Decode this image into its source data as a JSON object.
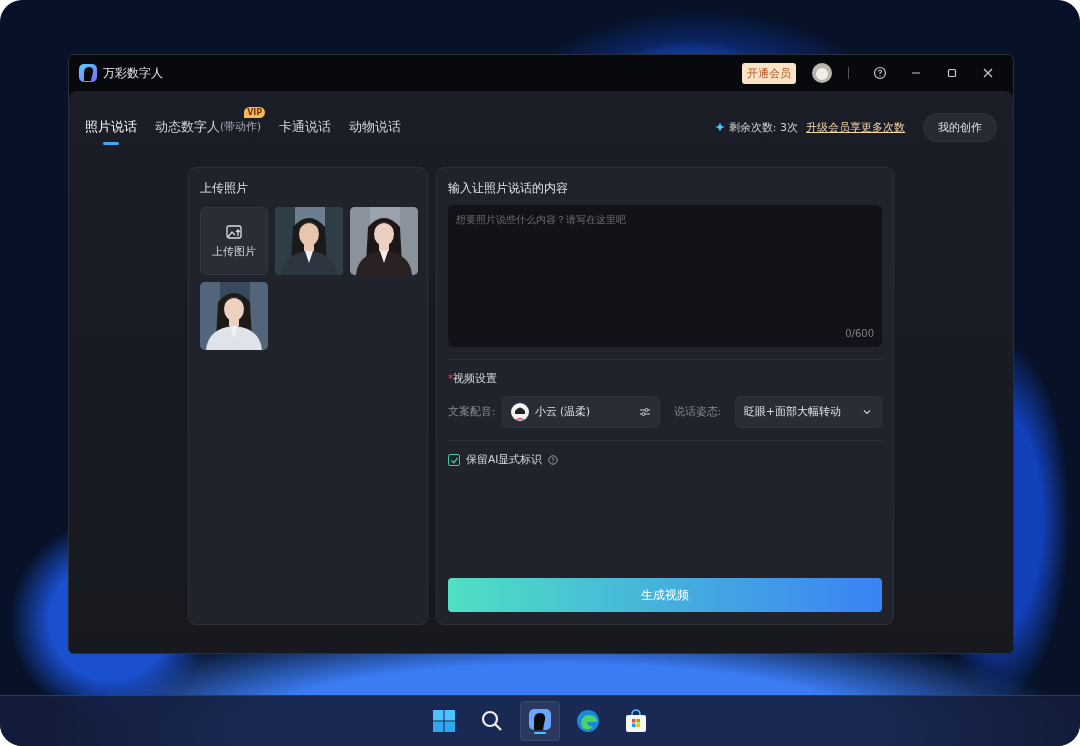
{
  "window": {
    "app_name": "万彩数字人",
    "vip_button": "开通会员"
  },
  "tabs": [
    {
      "label": "照片说话",
      "selected": true
    },
    {
      "label": "动态数字人",
      "sub": "(带动作)",
      "badge": "VIP",
      "selected": false
    },
    {
      "label": "卡通说话",
      "selected": false
    },
    {
      "label": "动物说话",
      "selected": false
    }
  ],
  "quota": {
    "text": "剩余次数: 3次",
    "link": "升级会员享更多次数"
  },
  "my_works_button": "我的创作",
  "upload_panel": {
    "title": "上传照片",
    "upload_label": "上传图片"
  },
  "content_panel": {
    "title": "输入让照片说话的内容",
    "placeholder": "想要照片说些什么内容？请写在这里吧",
    "counter": "0/600"
  },
  "video_settings": {
    "required_mark": "*",
    "title": "视频设置",
    "voice_label": "文案配音:",
    "voice_value": "小云 (温柔)",
    "pose_label": "说话姿态:",
    "pose_value": "眨眼+面部大幅转动"
  },
  "ai_mark": {
    "label": "保留AI显式标识",
    "checked": true
  },
  "generate_button": "生成视频"
}
